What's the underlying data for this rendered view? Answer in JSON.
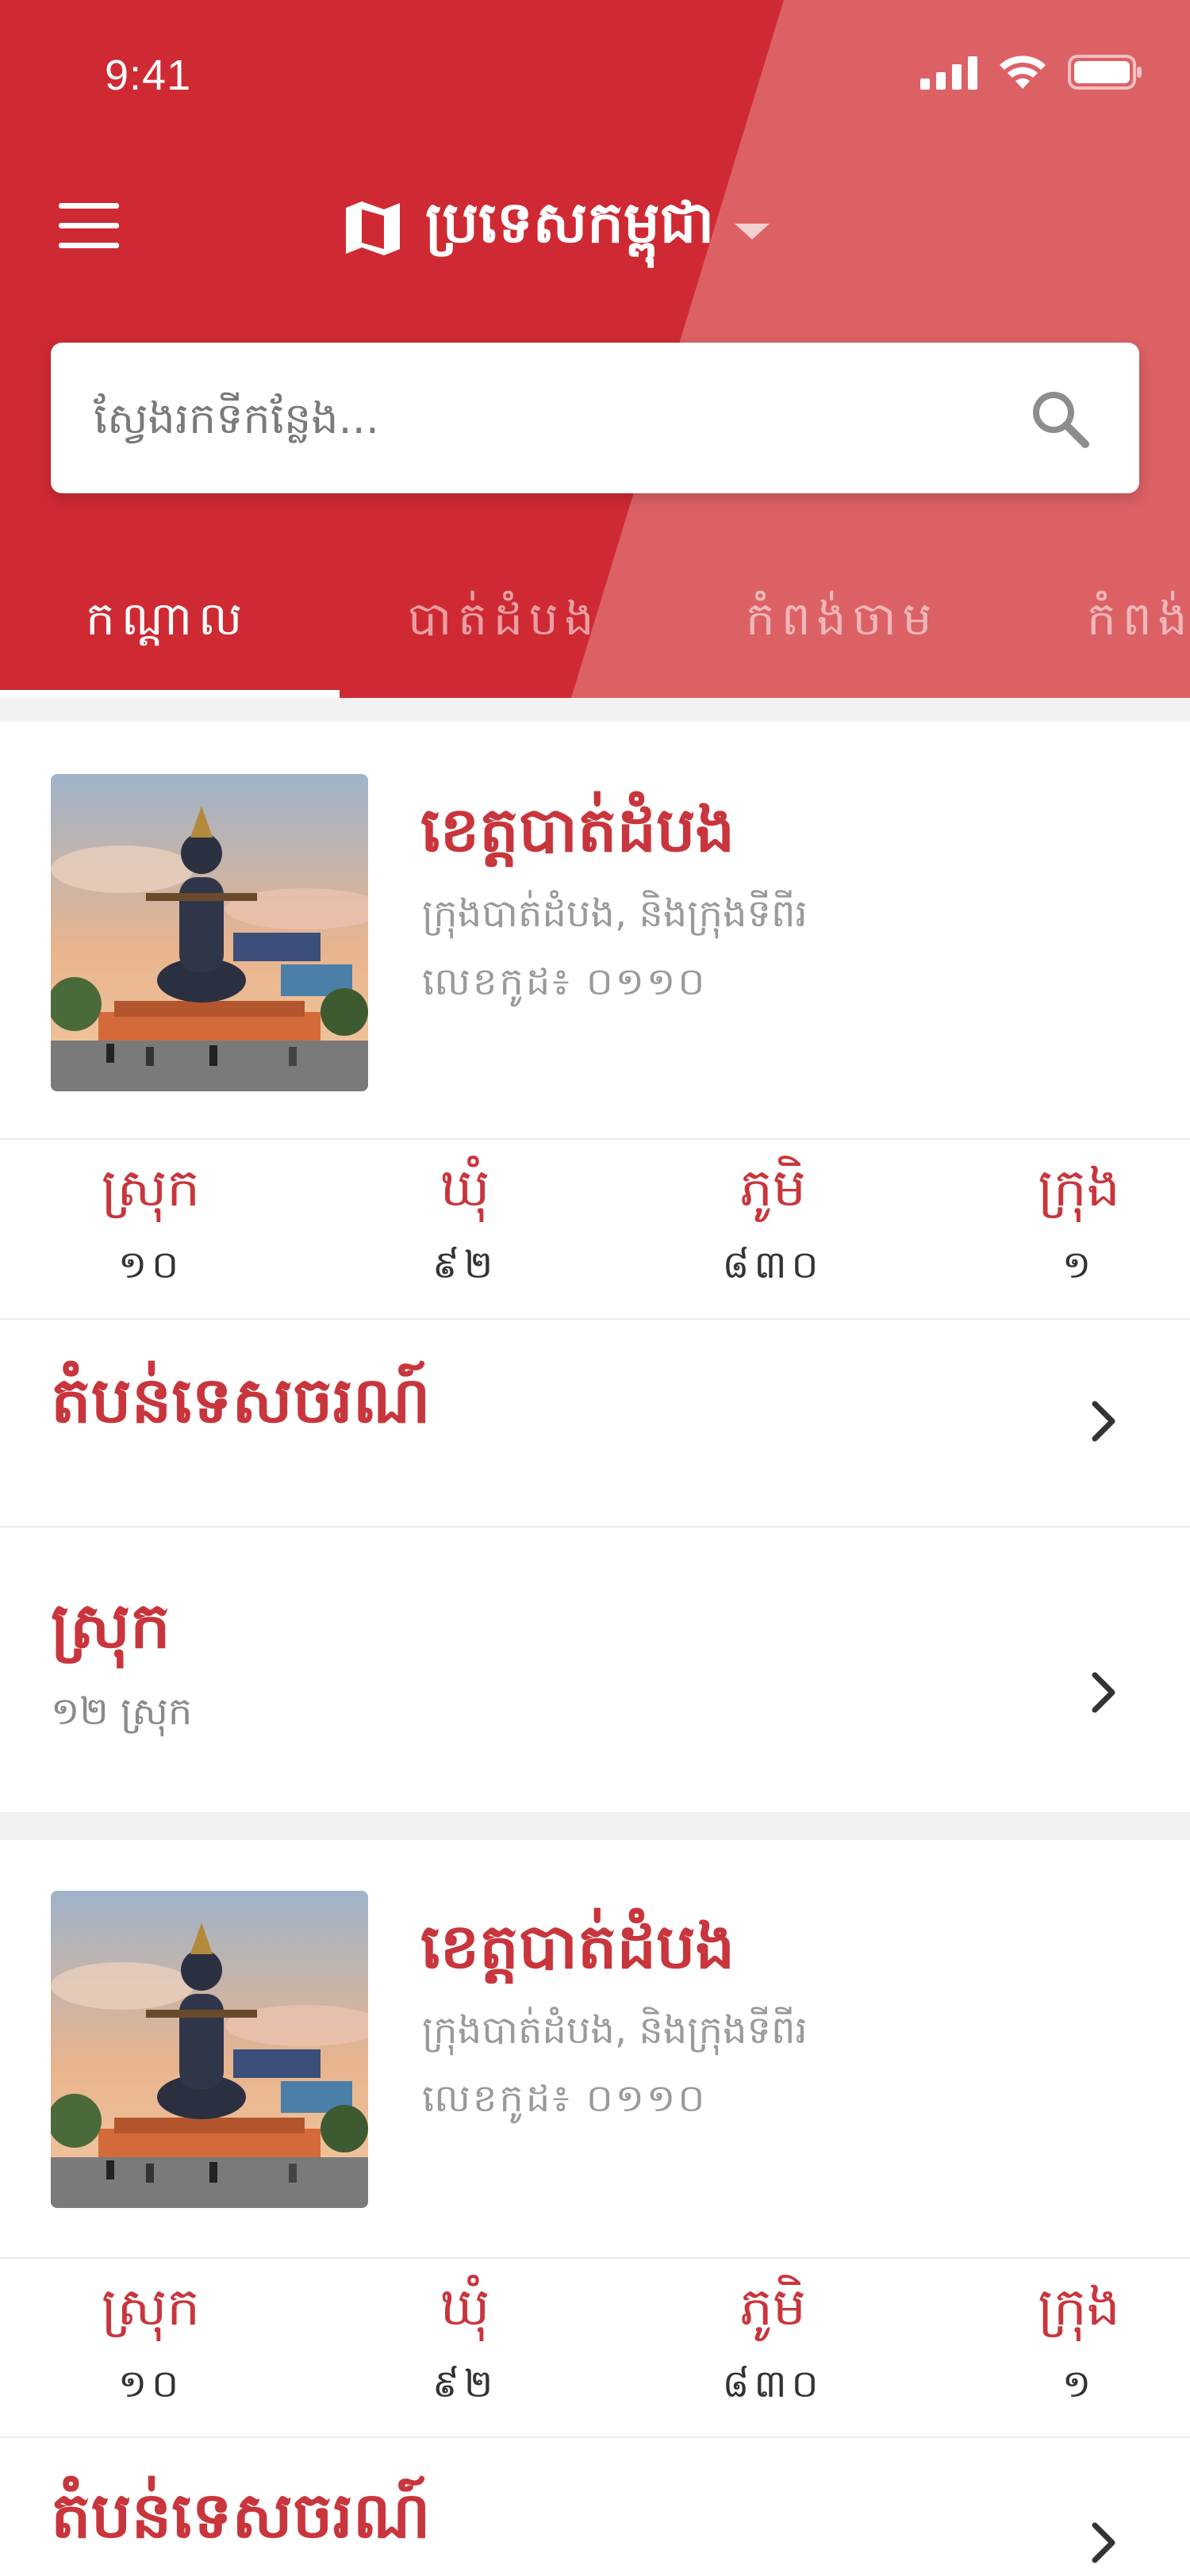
{
  "status_bar": {
    "time": "9:41"
  },
  "header": {
    "title": "ប្រទេសកម្ពុជា",
    "map_icon": "map-icon",
    "menu_icon": "hamburger-menu-icon"
  },
  "search": {
    "placeholder": "ស្វែងរកទីកន្លែង...",
    "icon": "search-icon"
  },
  "tabs": [
    {
      "label": "កណ្ដាល",
      "active": true
    },
    {
      "label": "បាត់ដំបង",
      "active": false
    },
    {
      "label": "កំពង់ចាម",
      "active": false
    },
    {
      "label": "កំពង់",
      "active": false
    }
  ],
  "cards": [
    {
      "name": "ខេត្តបាត់ដំបង",
      "subtitle": "ក្រុងបាត់ដំបង, និងក្រុងទីពីរ",
      "code": "លេខកូដ៖ ០១១០",
      "stats": [
        {
          "label": "ស្រុក",
          "value": "១០"
        },
        {
          "label": "ឃុំ",
          "value": "៩២"
        },
        {
          "label": "ភូមិ",
          "value": "៨៣០"
        },
        {
          "label": "ក្រុង",
          "value": "១"
        }
      ],
      "rows": [
        {
          "title": "តំបន់ទេសចរណ៍",
          "subtitle": ""
        },
        {
          "title": "ស្រុក",
          "subtitle": "១២ ស្រុក"
        }
      ]
    },
    {
      "name": "ខេត្តបាត់ដំបង",
      "subtitle": "ក្រុងបាត់ដំបង, និងក្រុងទីពីរ",
      "code": "លេខកូដ៖ ០១១០",
      "stats": [
        {
          "label": "ស្រុក",
          "value": "១០"
        },
        {
          "label": "ឃុំ",
          "value": "៩២"
        },
        {
          "label": "ភូមិ",
          "value": "៨៣០"
        },
        {
          "label": "ក្រុង",
          "value": "១"
        }
      ],
      "rows": [
        {
          "title": "តំបន់ទេសចរណ៍",
          "subtitle": ""
        }
      ]
    }
  ],
  "colors": {
    "primary": "#cf2a33",
    "primary_light": "#dc6165",
    "accent_text": "#c9353c"
  }
}
